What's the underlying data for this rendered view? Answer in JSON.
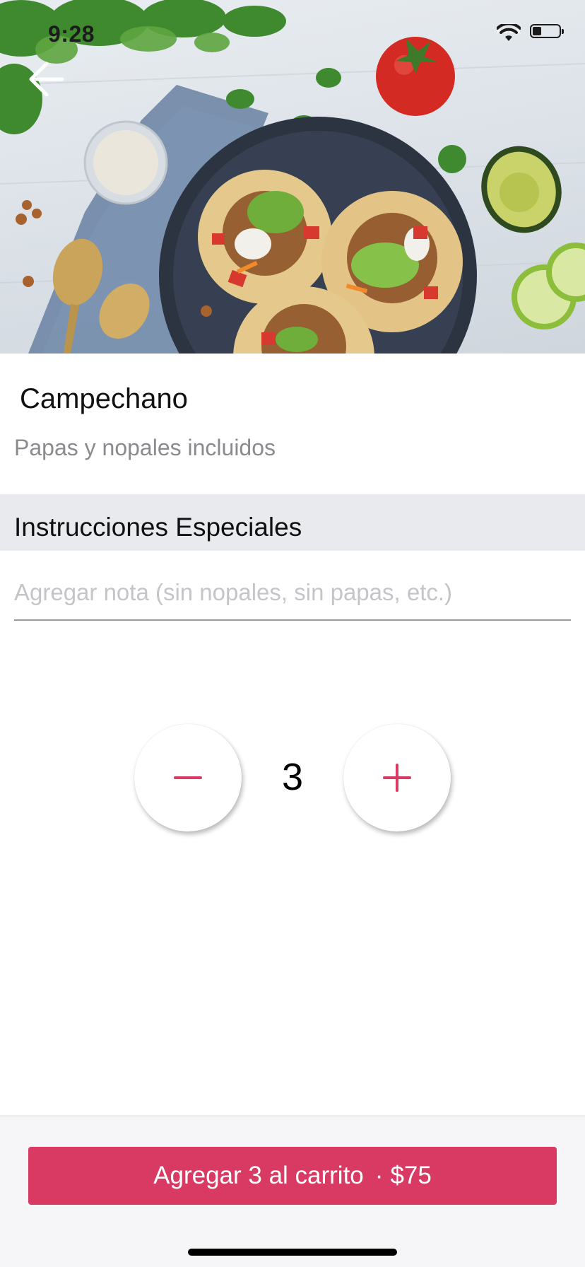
{
  "status_bar": {
    "time": "9:28"
  },
  "hero": {
    "image_description_icon": "tostadas-photo",
    "back_icon": "arrow-left-icon"
  },
  "product": {
    "name": "Campechano",
    "description": "Papas y nopales incluidos"
  },
  "instructions": {
    "title": "Instrucciones Especiales",
    "placeholder": "Agregar nota (sin nopales, sin papas, etc.)",
    "value": ""
  },
  "quantity": {
    "value": "3",
    "minus_icon": "minus-icon",
    "plus_icon": "plus-icon"
  },
  "cart_button": {
    "label": "Agregar 3 al carrito",
    "separator": "·",
    "price": "$75"
  },
  "colors": {
    "accent": "#d93a63",
    "section_bg": "#e9eaed",
    "muted_text": "#8a8a8f",
    "placeholder_text": "#c5c5c9"
  }
}
